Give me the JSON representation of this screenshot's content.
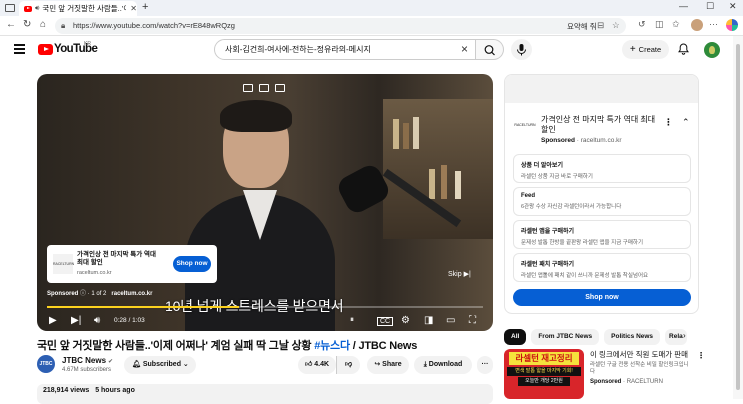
{
  "browser": {
    "tab_title": "국민 앞 거짓말한 사람들..'이",
    "url": "https://www.youtube.com/watch?v=rE848wRQzg",
    "summarize_label": "요약해 줘"
  },
  "header": {
    "logo_text": "YouTube",
    "region": "KR",
    "search_value": "사회-김건희-여사에-전하는-정유라의-메시지",
    "create_label": "Create"
  },
  "player": {
    "subtitle": "10년 넘게 스트레스를 받으면서",
    "skip_label": "Skip",
    "ad_title": "가격인상 전 마지막 특가 역대 최대 할인",
    "ad_domain": "raceltum.co.kr",
    "ad_logo": "RACELTURN",
    "shop_label": "Shop now",
    "ad_sponsored": "Sponsored",
    "ad_count": "1 of 2",
    "ad_domain2": "raceltum.co.kr",
    "time": "0:28 / 1:03",
    "progress_fraction": 0.44
  },
  "video": {
    "title": "국민 앞 거짓말한 사람들..'이제 어쩌나' 계엄 실패 딱 그날 상황",
    "hashtag": "#뉴스다",
    "title_suffix": "/ JTBC News",
    "channel": "JTBC News",
    "channel_logo": "JTBC",
    "subscribers": "4.67M subscribers",
    "subscribed_label": "Subscribed",
    "likes": "4.4K",
    "share_label": "Share",
    "download_label": "Download",
    "views": "218,914 views",
    "ago": "5 hours ago"
  },
  "side_ad": {
    "logo": "RACELTURN",
    "title": "가격인상 전 마지막 특가 역대 최대 할인",
    "sponsored": "Sponsored",
    "domain": "raceltum.co.kr",
    "items": [
      {
        "heading": "상품 더 알아보기",
        "text": "라셀턴 상품 지금 바로 구매하기"
      },
      {
        "heading": "Feed",
        "text": "6관왕 수상 자신감 라셀턴이라서 가능합니다"
      },
      {
        "heading": "라셀턴 앱을 구매하기",
        "text": "문제성 발톱 한방울 끝판왕 라셀턴 앱을 지금 구매하기"
      },
      {
        "heading": "라셀턴 패치 구매하기",
        "text": "라셀턴 앱톨에 패치 같이 쓰니까 문제성 발톱 착실넘어요"
      }
    ],
    "shop_label": "Shop now"
  },
  "chips": [
    "All",
    "From JTBC News",
    "Politics News",
    "Rela"
  ],
  "recommendation": {
    "thumb_line1": "라셀턴 재고정리",
    "thumb_line2": "변색 발톱 얇을 마지막 기회!",
    "thumb_line3": "오늘만 개당 2만원",
    "title": "이 링크에서만 직원 도매가 판매",
    "desc": "라셀턴 구글 전용 선착순 비밀 할인링크입니다",
    "sponsored": "Sponsored",
    "advertiser": "RACELTURN"
  }
}
